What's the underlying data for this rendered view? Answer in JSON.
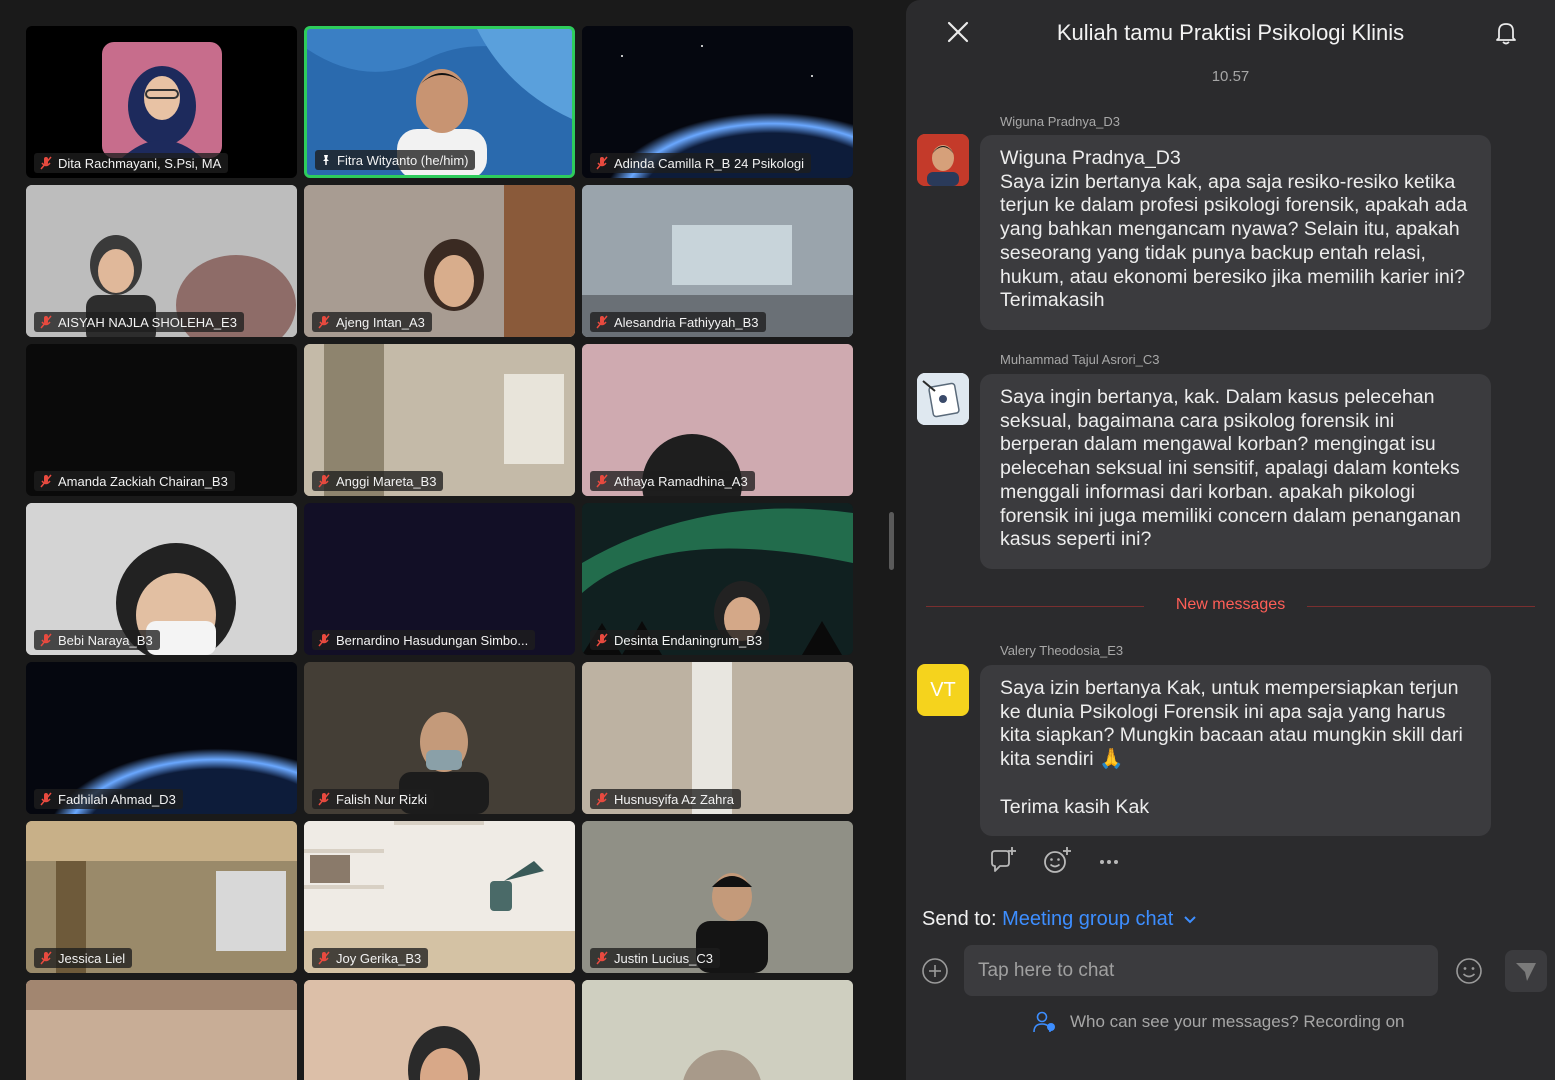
{
  "participants": [
    {
      "name": "Dita Rachmayani, S.Psi, MA",
      "muted": true
    },
    {
      "name": "Fitra Wityanto (he/him)",
      "pinned": true
    },
    {
      "name": "Adinda Camilla R_B 24 Psikologi",
      "muted": true
    },
    {
      "name": "AISYAH NAJLA SHOLEHA_E3",
      "muted": true
    },
    {
      "name": "Ajeng Intan_A3",
      "muted": true
    },
    {
      "name": "Alesandria Fathiyyah_B3",
      "muted": true
    },
    {
      "name": "Amanda Zackiah Chairan_B3",
      "muted": true
    },
    {
      "name": "Anggi Mareta_B3",
      "muted": true
    },
    {
      "name": "Athaya Ramadhina_A3",
      "muted": true
    },
    {
      "name": "Bebi Naraya_B3",
      "muted": true
    },
    {
      "name": "Bernardino Hasudungan Simbo...",
      "muted": true
    },
    {
      "name": "Desinta Endaningrum_B3",
      "muted": true
    },
    {
      "name": "Fadhilah Ahmad_D3",
      "muted": true
    },
    {
      "name": "Falish Nur Rizki",
      "muted": true
    },
    {
      "name": "Husnusyifa Az Zahra",
      "muted": true
    },
    {
      "name": "Jessica Liel",
      "muted": true
    },
    {
      "name": "Joy Gerika_B3",
      "muted": true
    },
    {
      "name": "Justin Lucius_C3",
      "muted": true
    }
  ],
  "chat": {
    "title": "Kuliah tamu Praktisi Psikologi Klinis",
    "time": "10.57",
    "messages": [
      {
        "sender": "Wiguna Pradnya_D3",
        "name_line": "Wiguna Pradnya_D3",
        "text": "Saya izin bertanya kak, apa saja resiko-resiko ketika terjun ke dalam profesi psikologi forensik, apakah ada yang bahkan mengancam nyawa? Selain itu, apakah seseorang yang tidak punya backup entah relasi, hukum, atau ekonomi beresiko jika memilih karier ini? Terimakasih"
      },
      {
        "sender": "Muhammad Tajul Asrori_C3",
        "text": "Saya ingin bertanya, kak. Dalam kasus pelecehan seksual, bagaimana cara psikolog forensik ini berperan dalam mengawal korban? mengingat isu pelecehan seksual ini sensitif, apalagi dalam konteks menggali informasi dari korban. apakah pikologi forensik ini juga memiliki concern dalam penanganan kasus seperti ini?"
      },
      {
        "sender": "Valery Theodosia_E3",
        "avatar_initials": "VT",
        "text": "Saya izin bertanya Kak, untuk mempersiapkan terjun ke dunia Psikologi Forensik ini apa saja yang harus kita siapkan? Mungkin bacaan atau mungkin skill dari kita sendiri 🙏",
        "text2": "Terima kasih Kak"
      }
    ],
    "new_messages_label": "New messages",
    "send_to_label": "Send to:",
    "send_to_target": "Meeting group chat",
    "input_placeholder": "Tap here to chat",
    "privacy_text": "Who can see your messages? Recording on"
  },
  "colors": {
    "accent_blue": "#3d8eff",
    "active_speaker": "#2ecc5c",
    "new_messages": "#ff5e57",
    "avatar_vt": "#f5d31d"
  }
}
